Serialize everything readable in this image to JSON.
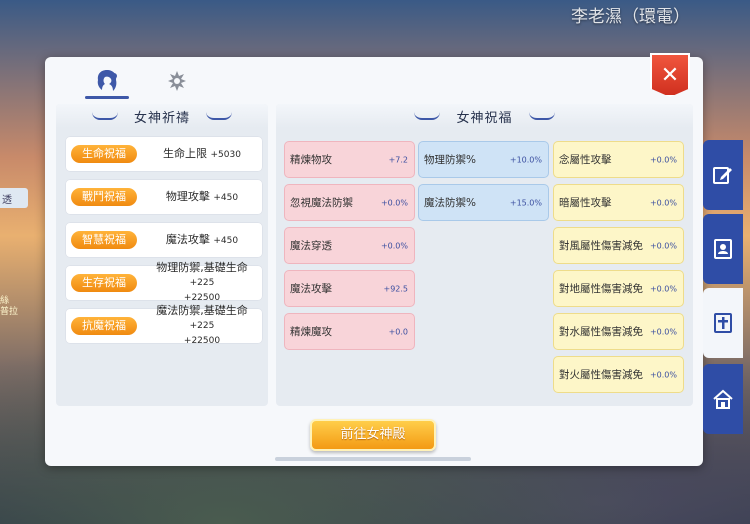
{
  "background": {
    "title": "李老濕（環電）"
  },
  "left_edge": {
    "text": "透",
    "label_lines": [
      "絲",
      "普拉"
    ]
  },
  "tabs": [
    {
      "icon": "goddess-head-icon",
      "active": true
    },
    {
      "icon": "emblem-icon",
      "active": false
    }
  ],
  "close": {
    "icon": "close-icon",
    "glyph": "✕"
  },
  "left_section": {
    "title": "女神祈禱",
    "rows": [
      {
        "badge": "生命祝福",
        "stat": "生命上限",
        "value": "+5030"
      },
      {
        "badge": "戰鬥祝福",
        "stat": "物理攻擊",
        "value": "+450"
      },
      {
        "badge": "智慧祝福",
        "stat": "魔法攻擊",
        "value": "+450"
      },
      {
        "badge": "生存祝福",
        "stat": "物理防禦,基礎生命",
        "value": "+225",
        "value2": "+22500"
      },
      {
        "badge": "抗魔祝福",
        "stat": "魔法防禦,基礎生命",
        "value": "+225",
        "value2": "+22500"
      }
    ]
  },
  "right_section": {
    "title": "女神祝福",
    "col1": [
      {
        "name": "精煉物攻",
        "value": "+7.2"
      },
      {
        "name": "忽視魔法防禦",
        "value": "+0.0%"
      },
      {
        "name": "魔法穿透",
        "value": "+0.0%"
      },
      {
        "name": "魔法攻擊",
        "value": "+92.5"
      },
      {
        "name": "精煉魔攻",
        "value": "+0.0"
      }
    ],
    "col2": [
      {
        "name": "物理防禦%",
        "value": "+10.0%"
      },
      {
        "name": "魔法防禦%",
        "value": "+15.0%"
      }
    ],
    "col3": [
      {
        "name": "念屬性攻擊",
        "value": "+0.0%"
      },
      {
        "name": "暗屬性攻擊",
        "value": "+0.0%"
      },
      {
        "name": "對風屬性傷害減免",
        "value": "+0.0%"
      },
      {
        "name": "對地屬性傷害減免",
        "value": "+0.0%"
      },
      {
        "name": "對水屬性傷害減免",
        "value": "+0.0%"
      },
      {
        "name": "對火屬性傷害減免",
        "value": "+0.0%"
      }
    ]
  },
  "goto_button": {
    "label": "前往女神殿"
  },
  "side_tabs": [
    {
      "icon": "edit-icon",
      "active": false
    },
    {
      "icon": "contact-book-icon",
      "active": false
    },
    {
      "icon": "cross-book-icon",
      "active": true
    },
    {
      "icon": "house-icon",
      "active": false
    }
  ],
  "colors": {
    "accent_blue": "#3e58a8",
    "badge_orange": "#f08a10",
    "close_red": "#d0301f"
  }
}
